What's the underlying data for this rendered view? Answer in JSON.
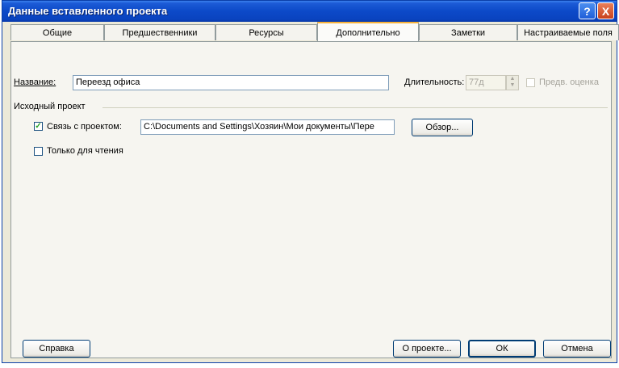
{
  "window": {
    "title": "Данные вставленного проекта"
  },
  "titlebar_buttons": {
    "help": "?",
    "close": "X"
  },
  "tabs": [
    {
      "label": "Общие"
    },
    {
      "label": "Предшественники"
    },
    {
      "label": "Ресурсы"
    },
    {
      "label": "Дополнительно"
    },
    {
      "label": "Заметки"
    },
    {
      "label": "Настраиваемые поля"
    }
  ],
  "active_tab": "Дополнительно",
  "fields": {
    "name_label": "Название:",
    "name_value": "Переезд офиса",
    "duration_label": "Длительность:",
    "duration_value": "77д",
    "estimated_label": "Предв. оценка",
    "estimated_checked": false
  },
  "source_group": {
    "title": "Исходный проект",
    "link_label": "Связь с проектом:",
    "link_checked": true,
    "link_path": "C:\\Documents and Settings\\Хозяин\\Мои документы\\Пере",
    "browse_label": "Обзор...",
    "readonly_label": "Только для чтения",
    "readonly_checked": false
  },
  "buttons": {
    "help": "Справка",
    "about": "О проекте...",
    "ok": "ОК",
    "cancel": "Отмена"
  },
  "glyphs": {
    "check": "✓",
    "up": "▲",
    "down": "▼"
  }
}
